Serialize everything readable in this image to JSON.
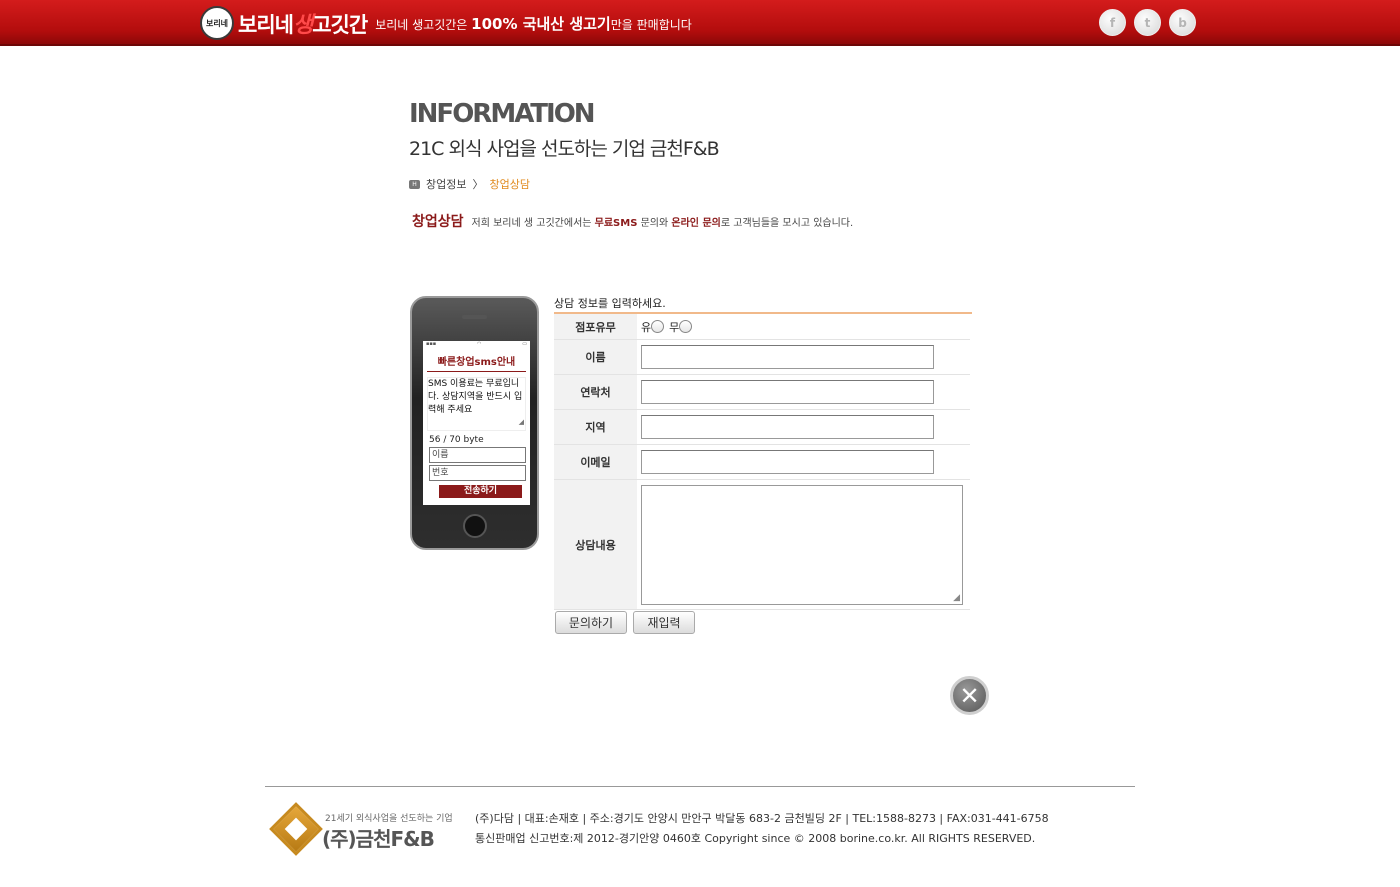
{
  "header": {
    "logo_badge": "보리네",
    "logo_part1": "보리네",
    "logo_saeng": "생",
    "logo_part2": "고깃간",
    "slogan_pre": "보리네 생고깃간은 ",
    "slogan_bold": "100% 국내산 생고기",
    "slogan_post": "만을 판매합니다",
    "social": [
      {
        "name": "facebook-icon",
        "glyph": "f"
      },
      {
        "name": "twitter-icon",
        "glyph": "t"
      },
      {
        "name": "blog-icon",
        "glyph": "b"
      }
    ]
  },
  "info": {
    "title": "INFORMATION",
    "subtitle": "21C 외식 사업을 선도하는 기업 금천F&B"
  },
  "breadcrumb": {
    "home": "H",
    "parent": "창업정보",
    "separator": "〉",
    "current": "창업상담"
  },
  "intro": {
    "label": "창업상담",
    "text_pre": "저희 보리네 생 고깃간에서는 ",
    "hl1": "무료SMS",
    "text_mid": " 문의와 ",
    "hl2": "온라인 문의",
    "text_post": "로 고객님들을 모시고 있습니다."
  },
  "phone": {
    "title": "빠른창업sms안내",
    "message": "SMS 이용료는 무료입니다. 상담지역을 반드시 입력해 주세요",
    "bytes": "56 / 70 byte",
    "name_placeholder": "이름",
    "phone_placeholder": "번호",
    "send_label": "전송하기"
  },
  "form": {
    "heading": "상담 정보를 입력하세요.",
    "store_label": "점포유무",
    "store_yes": "유",
    "store_no": "무",
    "name_label": "이름",
    "contact_label": "연락처",
    "region_label": "지역",
    "email_label": "이메일",
    "content_label": "상담내용",
    "submit_label": "문의하기",
    "reset_label": "재입력"
  },
  "footer": {
    "slogan": "21세기 외식사업을 선도하는 기업",
    "company_name": "(주)금천F&B",
    "line1": "(주)다담 | 대표:손재호  |  주소:경기도 안양시 만안구 박달동 683-2 금천빌딩 2F  |  TEL:1588-8273  |  FAX:031-441-6758",
    "line2": "통신판매업 신고번호:제 2012-경기안양 0460호   Copyright since © 2008 borine.co.kr. All RIGHTS RESERVED."
  },
  "colors": {
    "header_red": "#c01212",
    "accent_maroon": "#8b1a1a",
    "breadcrumb_orange": "#e08a1e",
    "form_line": "#f1b98a"
  }
}
